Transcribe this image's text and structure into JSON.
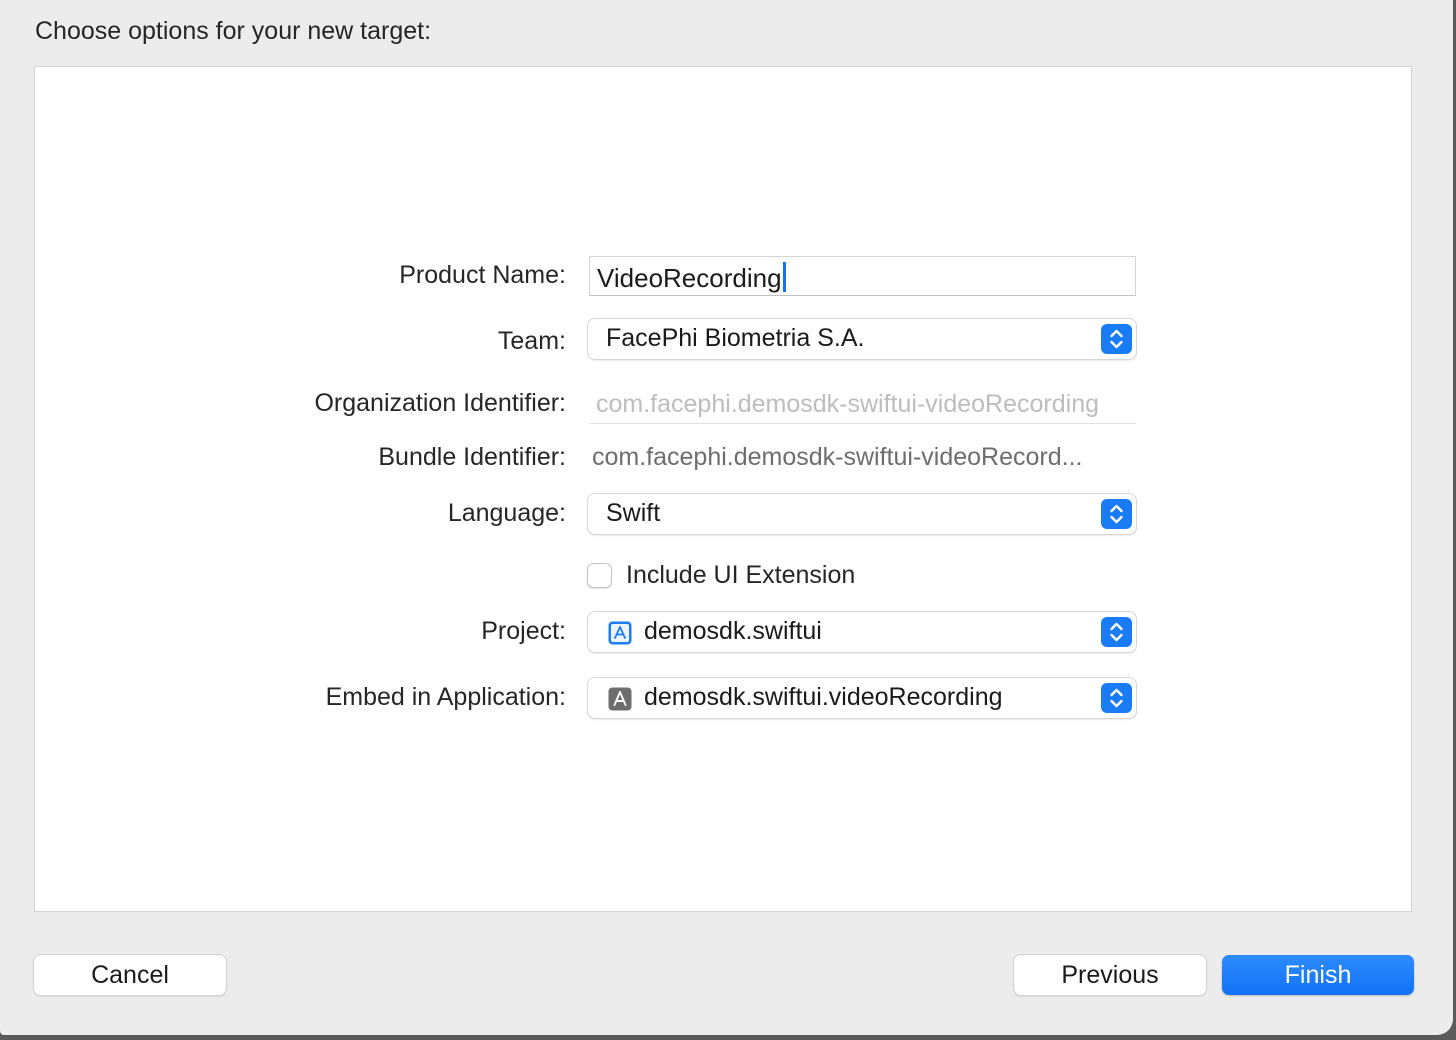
{
  "dialog": {
    "title": "Choose options for your new target:"
  },
  "form": {
    "product_name": {
      "label": "Product Name:",
      "value": "VideoRecording"
    },
    "team": {
      "label": "Team:",
      "value": "FacePhi Biometria S.A."
    },
    "organization_identifier": {
      "label": "Organization Identifier:",
      "value": "com.facephi.demosdk-swiftui-videoRecording"
    },
    "bundle_identifier": {
      "label": "Bundle Identifier:",
      "value": "com.facephi.demosdk-swiftui-videoRecord..."
    },
    "language": {
      "label": "Language:",
      "value": "Swift"
    },
    "include_ui_extension": {
      "label": "Include UI Extension",
      "checked": false
    },
    "project": {
      "label": "Project:",
      "value": "demosdk.swiftui",
      "icon": "xcode-project-icon"
    },
    "embed_in_application": {
      "label": "Embed in Application:",
      "value": "demosdk.swiftui.videoRecording",
      "icon": "app-target-icon"
    }
  },
  "buttons": {
    "cancel": "Cancel",
    "previous": "Previous",
    "finish": "Finish"
  },
  "colors": {
    "accent": "#1a7cf5",
    "sheet_background": "#ececec",
    "panel_background": "#ffffff"
  }
}
